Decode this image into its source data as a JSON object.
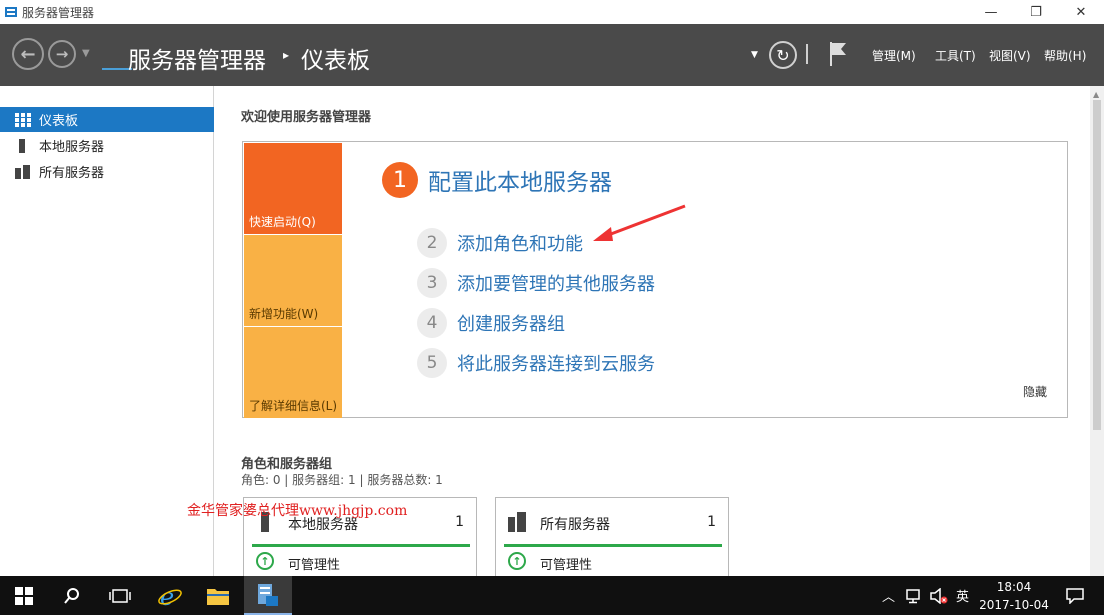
{
  "window": {
    "title": "服务器管理器"
  },
  "header": {
    "breadcrumb_app": "服务器管理器",
    "breadcrumb_page": "仪表板",
    "menus": [
      "管理(M)",
      "工具(T)",
      "视图(V)",
      "帮助(H)"
    ]
  },
  "sidebar": {
    "items": [
      {
        "label": "仪表板",
        "icon": "dashboard-icon",
        "active": true
      },
      {
        "label": "本地服务器",
        "icon": "local-server-icon",
        "active": false
      },
      {
        "label": "所有服务器",
        "icon": "all-servers-icon",
        "active": false
      }
    ]
  },
  "welcome": {
    "title": "欢迎使用服务器管理器",
    "tiles": [
      "快速启动(Q)",
      "新增功能(W)",
      "了解详细信息(L)"
    ],
    "steps": [
      {
        "num": "1",
        "label": "配置此本地服务器"
      },
      {
        "num": "2",
        "label": "添加角色和功能"
      },
      {
        "num": "3",
        "label": "添加要管理的其他服务器"
      },
      {
        "num": "4",
        "label": "创建服务器组"
      },
      {
        "num": "5",
        "label": "将此服务器连接到云服务"
      }
    ],
    "hide": "隐藏"
  },
  "roles": {
    "title": "角色和服务器组",
    "summary": "角色: 0 | 服务器组: 1 | 服务器总数: 1",
    "cards": [
      {
        "title": "本地服务器",
        "count": "1",
        "status": "可管理性"
      },
      {
        "title": "所有服务器",
        "count": "1",
        "status": "可管理性"
      }
    ]
  },
  "watermark": "金华管家婆总代理www.jhgjp.com",
  "taskbar": {
    "ime": "英",
    "time": "18:04",
    "date": "2017-10-04"
  },
  "colors": {
    "header_bg": "#4a4a4a",
    "accent_blue": "#1c78c4",
    "orange": "#f26522",
    "light_orange": "#f9b145",
    "green": "#2da84a"
  }
}
